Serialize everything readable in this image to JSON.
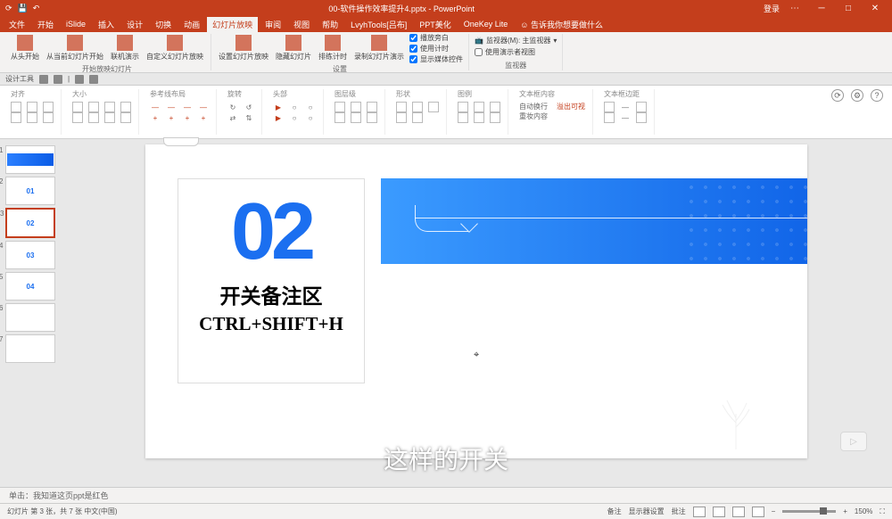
{
  "title": "00-软件操作效率提升4.pptx - PowerPoint",
  "titlebar_right": {
    "signin": "登录"
  },
  "tabs": [
    "文件",
    "开始",
    "iSlide",
    "插入",
    "设计",
    "切换",
    "动画",
    "幻灯片放映",
    "审阅",
    "视图",
    "帮助",
    "LvyhTools[吕布]",
    "PPT美化",
    "OneKey Lite",
    "☺ 告诉我你想要做什么"
  ],
  "active_tab_index": 7,
  "ribbon": {
    "g1": {
      "b1": "从头开始",
      "b2": "从当前幻灯片开始",
      "b3": "联机演示",
      "b4": "自定义幻灯片放映",
      "label": "开始放映幻灯片"
    },
    "g2": {
      "b1": "设置幻灯片放映",
      "b2": "隐藏幻灯片",
      "b3": "排练计时",
      "b4": "录制幻灯片演示",
      "c1": "播放旁白",
      "c2": "使用计时",
      "c3": "显示媒体控件",
      "label": "设置"
    },
    "g3": {
      "l1": "监视器(M): 主监视器",
      "c1": "使用演示者视图",
      "label": "监视器"
    }
  },
  "qat_label": "设计工具",
  "subribbon": {
    "g1": "对齐",
    "g2": "大小",
    "g3": "参考线布局",
    "g4": "旋转",
    "g5": "头部",
    "g6": "图层级",
    "g7": "形状",
    "g8": "图例",
    "g9": "文本框内容",
    "g9a": "自动换行",
    "g9b": "溢出可视",
    "g9c": "重妆内容",
    "g10": "文本框边距"
  },
  "thumbs": [
    {
      "n": "1",
      "type": "blue"
    },
    {
      "n": "2",
      "type": "list",
      "t": "01"
    },
    {
      "n": "3",
      "type": "current",
      "t": "02"
    },
    {
      "n": "4",
      "type": "list",
      "t": "03"
    },
    {
      "n": "5",
      "type": "list",
      "t": "04"
    },
    {
      "n": "6",
      "type": "blank"
    },
    {
      "n": "7",
      "type": "blank"
    }
  ],
  "slide": {
    "number": "02",
    "title": "开关备注区",
    "subtitle": "CTRL+SHIFT+H"
  },
  "notes": "单击：我知道这页ppt是红色",
  "caption": "这样的开关",
  "status": {
    "left": "幻灯片 第 3 张，共 7 张   中文(中国)",
    "notes_btn": "备注",
    "display_btn": "显示器设置",
    "comments": "批注",
    "zoom": "150%"
  }
}
